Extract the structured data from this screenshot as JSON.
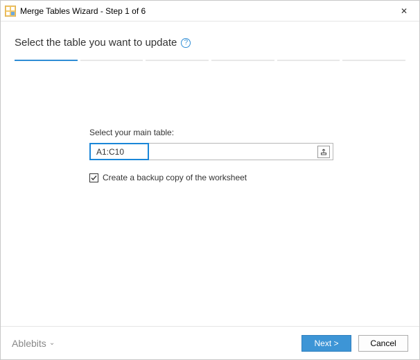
{
  "window": {
    "title": "Merge Tables Wizard - Step 1 of 6"
  },
  "heading": "Select the table you want to update",
  "help_glyph": "?",
  "progress": {
    "total": 6,
    "current": 1
  },
  "form": {
    "main_table_label": "Select your main table:",
    "range_value": "A1:C10",
    "backup_checked": true,
    "backup_label": "Create a backup copy of the worksheet"
  },
  "footer": {
    "brand": "Ablebits",
    "next_label": "Next >",
    "cancel_label": "Cancel"
  },
  "glyphs": {
    "close": "✕",
    "check": "✓",
    "chevron_down": "⌄",
    "upload": "⇱"
  }
}
